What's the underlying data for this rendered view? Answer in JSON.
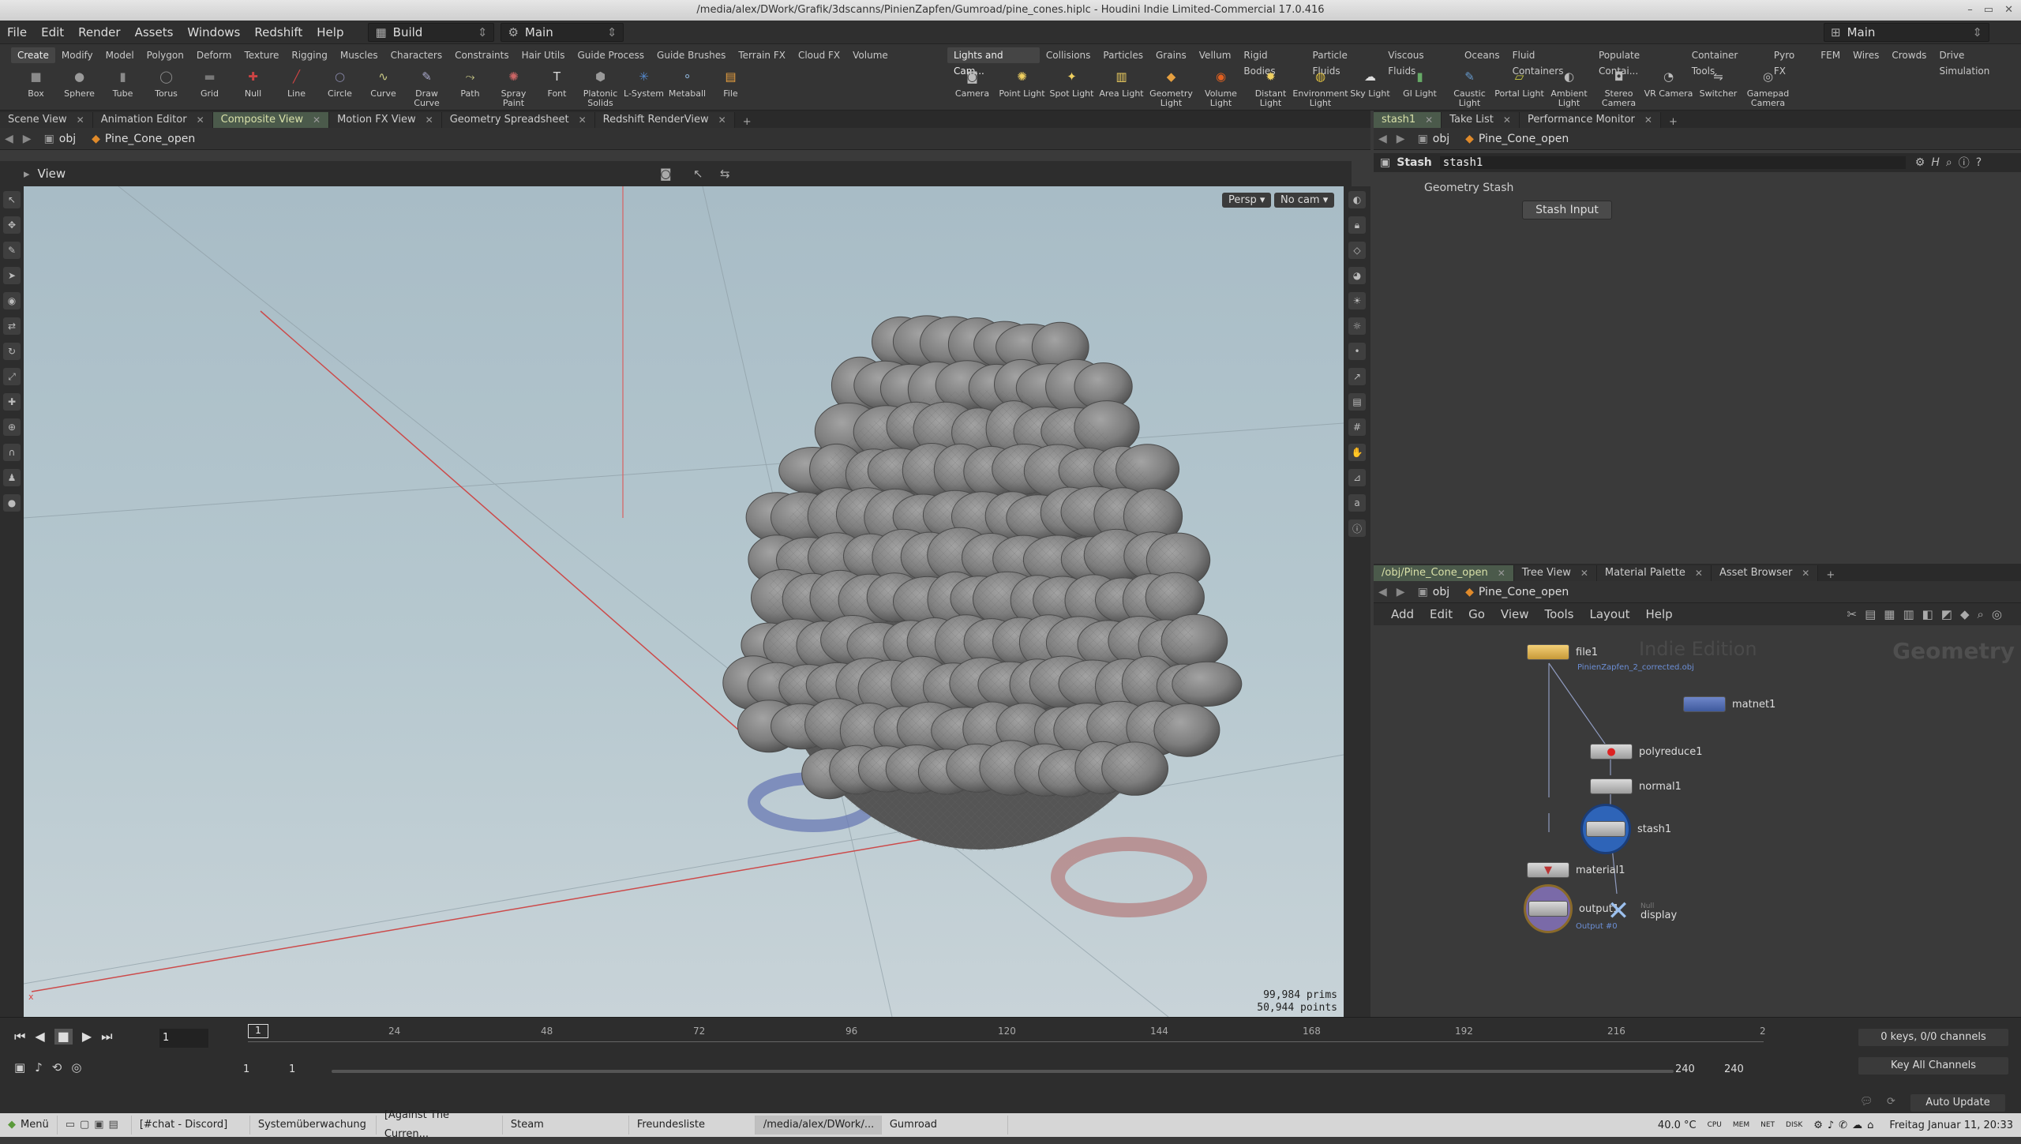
{
  "window": {
    "title": "/media/alex/DWork/Grafik/3dscanns/PinienZapfen/Gumroad/pine_cones.hiplc - Houdini Indie Limited-Commercial 17.0.416"
  },
  "menu": {
    "items": [
      "File",
      "Edit",
      "Render",
      "Assets",
      "Windows",
      "Redshift",
      "Help"
    ],
    "desktop": "Build",
    "desktop_main": "Main",
    "right_desktop": "Main"
  },
  "shelf_left": {
    "tabs": [
      "Create",
      "Modify",
      "Model",
      "Polygon",
      "Deform",
      "Texture",
      "Rigging",
      "Muscles",
      "Characters",
      "Constraints",
      "Hair Utils",
      "Guide Process",
      "Guide Brushes",
      "Terrain FX",
      "Cloud FX",
      "Volume"
    ],
    "tools": [
      "Box",
      "Sphere",
      "Tube",
      "Torus",
      "Grid",
      "Null",
      "Line",
      "Circle",
      "Curve",
      "Draw Curve",
      "Path",
      "Spray Paint",
      "Font",
      "Platonic Solids",
      "L-System",
      "Metaball",
      "File"
    ]
  },
  "shelf_right": {
    "tabs": [
      "Lights and Cam...",
      "Collisions",
      "Particles",
      "Grains",
      "Vellum",
      "Rigid Bodies",
      "Particle Fluids",
      "Viscous Fluids",
      "Oceans",
      "Fluid Containers",
      "Populate Contai...",
      "Container Tools",
      "Pyro FX",
      "FEM",
      "Wires",
      "Crowds",
      "Drive Simulation"
    ],
    "tools": [
      "Camera",
      "Point Light",
      "Spot Light",
      "Area Light",
      "Geometry Light",
      "Volume Light",
      "Distant Light",
      "Environment Light",
      "Sky Light",
      "GI Light",
      "Caustic Light",
      "Portal Light",
      "Ambient Light",
      "Stereo Camera",
      "VR Camera",
      "Switcher",
      "Gamepad Camera"
    ]
  },
  "pane_tabs": [
    "Scene View",
    "Animation Editor",
    "Composite View",
    "Motion FX View",
    "Geometry Spreadsheet",
    "Redshift RenderView"
  ],
  "path": {
    "root": "obj",
    "node": "Pine_Cone_open"
  },
  "view": {
    "label": "View",
    "persp": "Persp ▾",
    "cam": "No cam ▾",
    "prims": "99,984  prims",
    "points": "50,944 points"
  },
  "param_pane": {
    "tabs": [
      "stash1",
      "Take List",
      "Performance Monitor"
    ],
    "node_type": "Stash",
    "node_name": "stash1",
    "section": "Geometry Stash",
    "button": "Stash Input"
  },
  "network_pane": {
    "tabs": [
      "/obj/Pine_Cone_open",
      "Tree View",
      "Material Palette",
      "Asset Browser"
    ],
    "menu": [
      "Add",
      "Edit",
      "Go",
      "View",
      "Tools",
      "Layout",
      "Help"
    ],
    "watermark": "Indie Edition",
    "context": "Geometry",
    "nodes": {
      "file1": "file1",
      "file1_sub": "PinienZapfen_2_corrected.obj",
      "matnet1": "matnet1",
      "polyreduce1": "polyreduce1",
      "normal1": "normal1",
      "stash1": "stash1",
      "material1": "material1",
      "output1": "output1",
      "output1_sub": "Output #0",
      "null_label": "Null",
      "display": "display"
    }
  },
  "timeline": {
    "ticks": [
      "24",
      "48",
      "72",
      "96",
      "120",
      "144",
      "168",
      "192",
      "216",
      "2"
    ],
    "current_frame": "1",
    "frame_marker": "1",
    "start": "1",
    "start2": "1",
    "end": "240",
    "end2": "240",
    "keys": "0 keys, 0/0 channels",
    "key_all": "Key All Channels",
    "auto_update": "Auto Update"
  },
  "taskbar": {
    "menu": "Menü",
    "items": [
      "[#chat - Discord]",
      "Systemüberwachung",
      "[Against The Curren...",
      "Steam",
      "Freundesliste",
      "/media/alex/DWork/...",
      "Gumroad"
    ],
    "temp": "40.0 °C",
    "labels": [
      "CPU",
      "MEM",
      "NET",
      "DISK"
    ],
    "clock": "Freitag Januar 11, 20:33"
  }
}
